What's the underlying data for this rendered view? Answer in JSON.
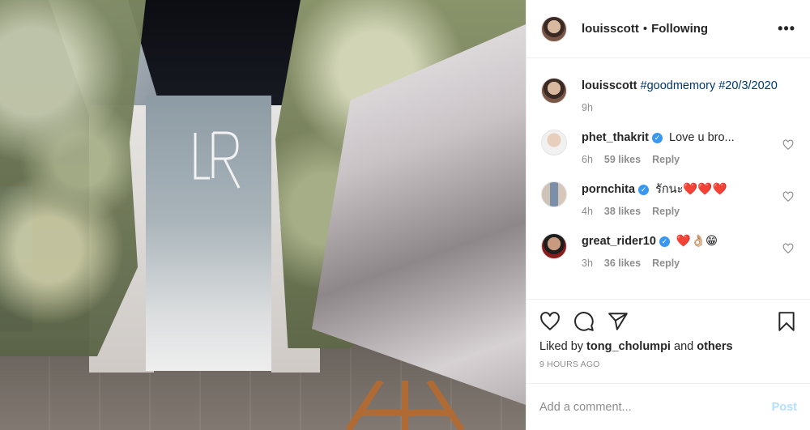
{
  "post": {
    "author": "louisscott",
    "follow_state": "Following",
    "more_icon": "more-horizontal-icon",
    "caption": {
      "user": "louisscott",
      "hashtags": "#goodmemory #20/3/2020",
      "time": "9h"
    },
    "comments": [
      {
        "user": "phet_thakrit",
        "verified": true,
        "text": "Love u bro...",
        "time": "6h",
        "likes": "59 likes",
        "reply": "Reply"
      },
      {
        "user": "pornchita",
        "verified": true,
        "text": "รักนะ❤️❤️❤️",
        "time": "4h",
        "likes": "38 likes",
        "reply": "Reply"
      },
      {
        "user": "great_rider10",
        "verified": true,
        "text": "❤️👌🏼😁",
        "time": "3h",
        "likes": "36 likes",
        "reply": "Reply"
      }
    ],
    "liked_by_prefix": "Liked by",
    "liked_by_user": "tong_cholumpi",
    "liked_by_and": "and",
    "liked_by_others": "others",
    "time_ago": "9 HOURS AGO",
    "add_comment_placeholder": "Add a comment...",
    "post_button": "Post"
  },
  "colors": {
    "link": "#00376b",
    "muted": "#8e8e8e",
    "verified": "#3897f0",
    "post_disabled": "#b2dffc"
  }
}
